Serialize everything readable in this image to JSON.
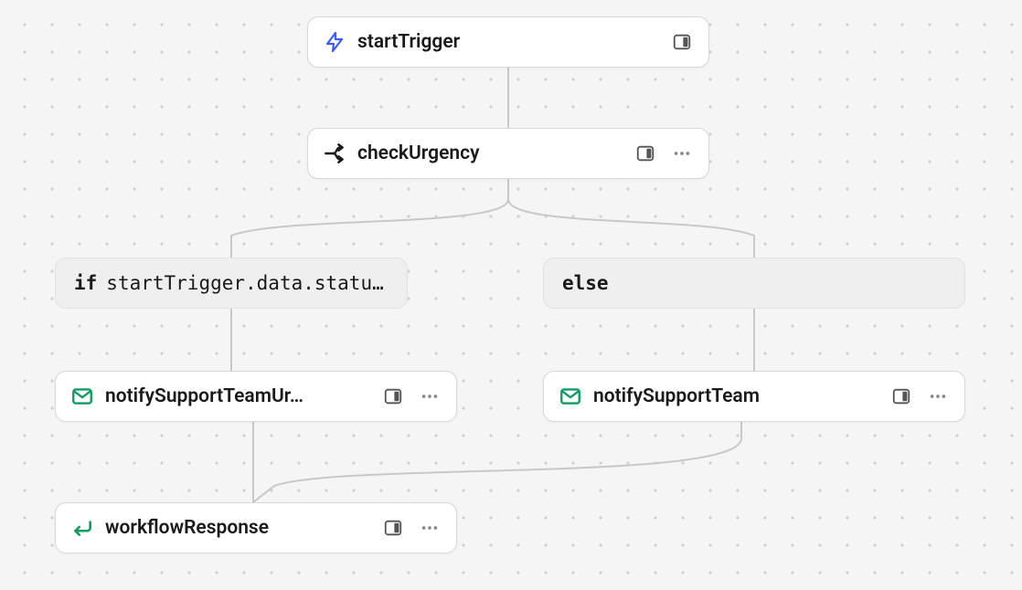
{
  "nodes": {
    "startTrigger": {
      "label": "startTrigger"
    },
    "checkUrgency": {
      "label": "checkUrgency"
    },
    "notifyUrgent": {
      "label": "notifySupportTeamUr…"
    },
    "notifyNormal": {
      "label": "notifySupportTeam"
    },
    "workflowResponse": {
      "label": "workflowResponse"
    }
  },
  "conditions": {
    "ifBranch": {
      "keyword": "if",
      "expression": "startTrigger.data.status…"
    },
    "elseBranch": {
      "keyword": "else"
    }
  }
}
